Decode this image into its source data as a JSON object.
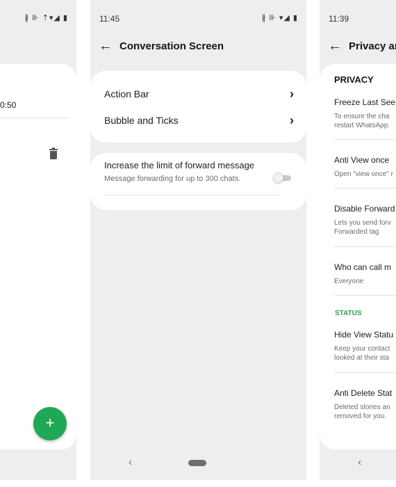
{
  "left_screen": {
    "status_icons": "∦ ⊪ ⇡▾◢ ▮",
    "time_value": "0:50",
    "fab_icon": "plus-icon",
    "fab_label": "+"
  },
  "middle_screen": {
    "status_time": "11:45",
    "status_icons": "∦ ⊪ ▾◢ ▮",
    "title": "Conversation Screen",
    "nav_items": [
      {
        "label": "Action Bar"
      },
      {
        "label": "Bubble and Ticks"
      }
    ],
    "toggle_setting": {
      "title": "Increase the limit of forward message",
      "subtitle": "Message forwarding for up to 300 chats.",
      "enabled": false
    },
    "navbar_back": "‹"
  },
  "right_screen": {
    "status_time": "11:39",
    "title": "Privacy ar",
    "section_privacy": "PRIVACY",
    "section_status": "STATUS",
    "items": [
      {
        "title": "Freeze Last See",
        "subtitle_lines": [
          "To ensure the cha",
          "restart WhatsApp."
        ]
      },
      {
        "title": "Anti View once",
        "subtitle_lines": [
          "Open \"view once\" r"
        ]
      },
      {
        "title": "Disable Forward",
        "subtitle_lines": [
          "Lets you send forv",
          "Forwarded tag"
        ]
      },
      {
        "title": "Who can call m",
        "subtitle_lines": [
          "Everyone"
        ]
      },
      {
        "title": "Hide View Statu",
        "subtitle_lines": [
          "Keep your contact",
          "looked at their sta"
        ]
      },
      {
        "title": "Anti Delete Stat",
        "subtitle_lines": [
          "Deleted stories an",
          "removed for you."
        ]
      }
    ],
    "navbar_back": "‹"
  },
  "colors": {
    "background": "#eceef0",
    "card": "#ffffff",
    "accent_green": "#1fa855",
    "status_green": "#2aa34c"
  }
}
